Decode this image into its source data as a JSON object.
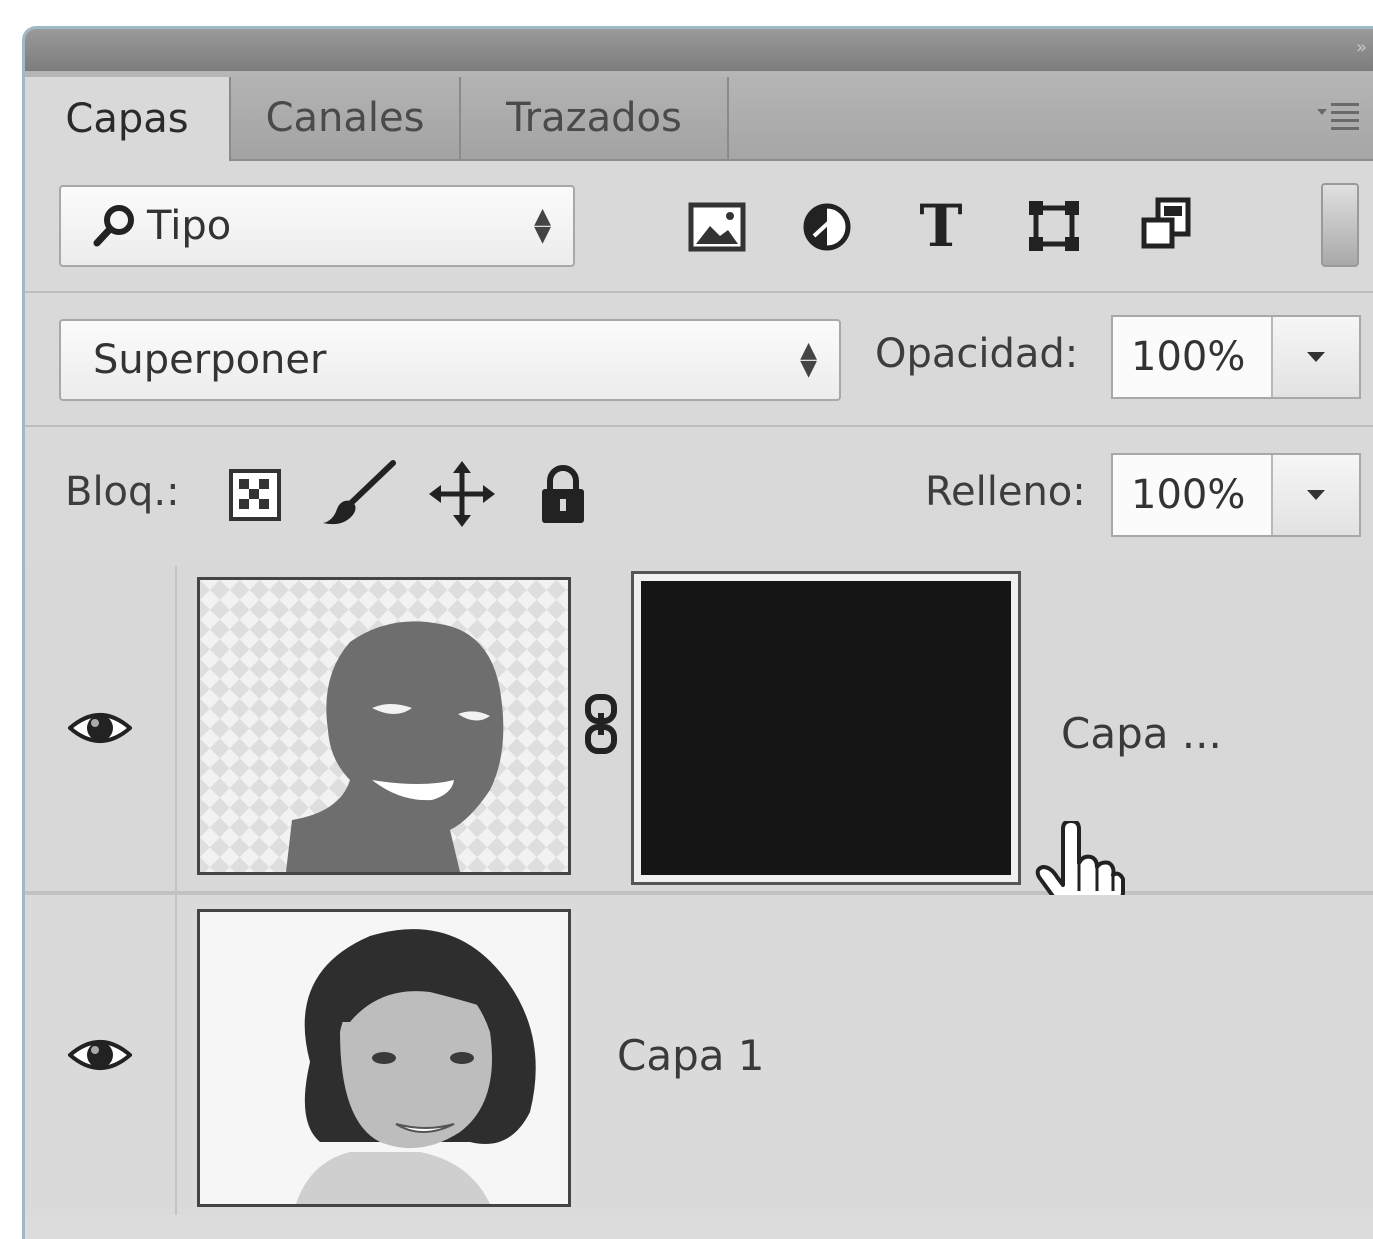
{
  "tabs": [
    {
      "label": "Capas",
      "active": true
    },
    {
      "label": "Canales",
      "active": false
    },
    {
      "label": "Trazados",
      "active": false
    }
  ],
  "filter": {
    "search_icon": "search-icon",
    "value": "Tipo",
    "filter_icons": [
      "image-filter-icon",
      "adjustment-filter-icon",
      "type-filter-icon",
      "shape-filter-icon",
      "smart-object-filter-icon"
    ]
  },
  "blend": {
    "mode": "Superponer",
    "opacity_label": "Opacidad:",
    "opacity_value": "100%"
  },
  "lock": {
    "label": "Bloq.:",
    "fill_label": "Relleno:",
    "fill_value": "100%"
  },
  "layers": [
    {
      "name": "Capa ...",
      "visible": true,
      "has_mask": true
    },
    {
      "name": "Capa 1",
      "visible": true,
      "has_mask": false
    }
  ],
  "colors": {
    "panel_bg": "#d9d9d9",
    "tab_bar": "#a6a6a6",
    "mask_fill": "#151515"
  }
}
